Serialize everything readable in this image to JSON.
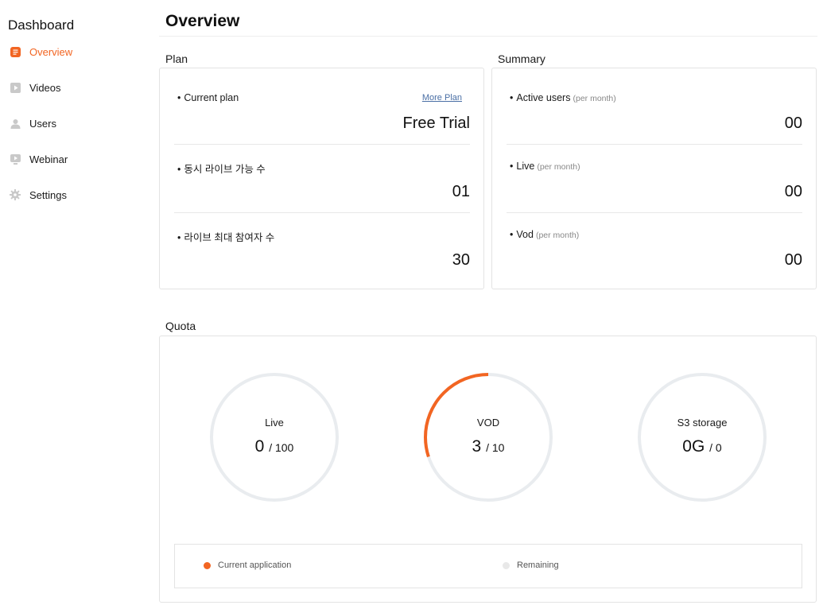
{
  "sidebar": {
    "title": "Dashboard",
    "items": [
      {
        "label": "Overview",
        "icon": "document-icon",
        "active": true
      },
      {
        "label": "Videos",
        "icon": "video-play-icon",
        "active": false
      },
      {
        "label": "Users",
        "icon": "user-icon",
        "active": false
      },
      {
        "label": "Webinar",
        "icon": "webinar-icon",
        "active": false
      },
      {
        "label": "Settings",
        "icon": "gear-icon",
        "active": false
      }
    ]
  },
  "header": {
    "title": "Overview"
  },
  "plan": {
    "title": "Plan",
    "current_plan_label": "Current plan",
    "more_plan_link": "More Plan",
    "current_plan_value": "Free Trial",
    "concurrent_live_label": "동시 라이브 가능 수",
    "concurrent_live_value": "01",
    "max_participants_label": "라이브 최대 참여자 수",
    "max_participants_value": "30"
  },
  "summary": {
    "title": "Summary",
    "active_users_label": "Active users",
    "active_users_sub": "(per month)",
    "active_users_value": "00",
    "live_label": "Live",
    "live_sub": "(per month)",
    "live_value": "00",
    "vod_label": "Vod",
    "vod_sub": "(per month)",
    "vod_value": "00"
  },
  "quota": {
    "title": "Quota",
    "gauges": [
      {
        "label": "Live",
        "used": "0",
        "total": "/ 100",
        "fraction": 0
      },
      {
        "label": "VOD",
        "used": "3",
        "total": "/ 10",
        "fraction": 0.3
      },
      {
        "label": "S3 storage",
        "used": "0G",
        "total": "/ 0",
        "fraction": 0
      }
    ],
    "legend": {
      "current_label": "Current application",
      "remaining_label": "Remaining"
    }
  },
  "colors": {
    "accent": "#f26522",
    "track": "#e9ecef",
    "remaining_dot": "#e8e8e8"
  }
}
